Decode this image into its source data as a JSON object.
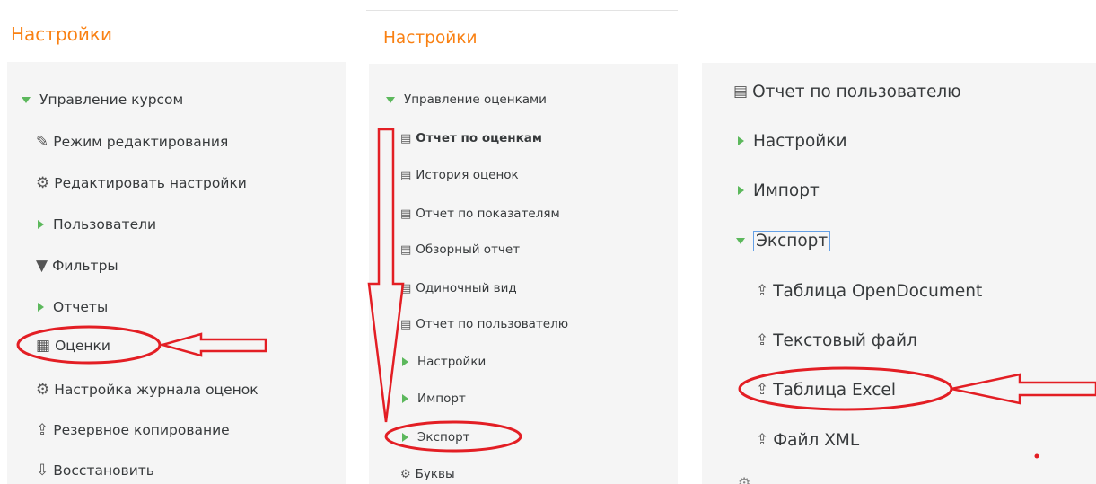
{
  "panel1": {
    "heading": "Настройки",
    "items": [
      {
        "label": "Управление курсом",
        "icon": "triangle-down-icon"
      },
      {
        "label": "Режим редактирования",
        "icon": "pencil-icon"
      },
      {
        "label": "Редактировать настройки",
        "icon": "gear-icon"
      },
      {
        "label": "Пользователи",
        "icon": "triangle-right-icon"
      },
      {
        "label": "Фильтры",
        "icon": "filter-icon"
      },
      {
        "label": "Отчеты",
        "icon": "triangle-right-icon"
      },
      {
        "label": "Оценки",
        "icon": "table-icon"
      },
      {
        "label": "Настройка журнала оценок",
        "icon": "gear-icon"
      },
      {
        "label": "Резервное копирование",
        "icon": "upload-icon"
      },
      {
        "label": "Восстановить",
        "icon": "download-icon"
      }
    ]
  },
  "panel2": {
    "heading": "Настройки",
    "items": [
      {
        "label": "Управление оценками",
        "icon": "triangle-down-icon"
      },
      {
        "label": "Отчет по оценкам",
        "icon": "report-icon"
      },
      {
        "label": "История оценок",
        "icon": "report-icon"
      },
      {
        "label": "Отчет по показателям",
        "icon": "report-icon"
      },
      {
        "label": "Обзорный отчет",
        "icon": "report-icon"
      },
      {
        "label": "Одиночный вид",
        "icon": "report-icon"
      },
      {
        "label": "Отчет по пользователю",
        "icon": "report-icon"
      },
      {
        "label": "Настройки",
        "icon": "triangle-right-icon"
      },
      {
        "label": "Импорт",
        "icon": "triangle-right-icon"
      },
      {
        "label": "Экспорт",
        "icon": "triangle-right-icon"
      },
      {
        "label": "Буквы",
        "icon": "gear-icon"
      }
    ]
  },
  "panel3": {
    "items": [
      {
        "label": "Отчет по пользователю",
        "icon": "report-icon"
      },
      {
        "label": "Настройки",
        "icon": "triangle-right-icon"
      },
      {
        "label": "Импорт",
        "icon": "triangle-right-icon"
      },
      {
        "label": "Экспорт",
        "icon": "triangle-down-icon"
      },
      {
        "label": "Таблица OpenDocument",
        "icon": "upload-icon"
      },
      {
        "label": "Текстовый файл",
        "icon": "upload-icon"
      },
      {
        "label": "Таблица Excel",
        "icon": "upload-icon"
      },
      {
        "label": "Файл XML",
        "icon": "upload-icon"
      }
    ]
  },
  "colors": {
    "heading": "#f98012",
    "expander": "#5cb85c",
    "annotation": "#e31e24",
    "selection": "#64a0e6"
  }
}
